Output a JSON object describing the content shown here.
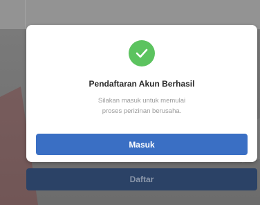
{
  "dialog": {
    "title": "Pendaftaran Akun Berhasil",
    "message_line1": "Silakan masuk untuk memulai",
    "message_line2": "proses perizinan berusaha.",
    "primary_button": "Masuk",
    "icon": "check-icon"
  },
  "background": {
    "secondary_button": "Daftar"
  },
  "colors": {
    "success": "#5cc35f",
    "primary": "#3a6fc4",
    "backdrop_button": "#2b4266"
  }
}
